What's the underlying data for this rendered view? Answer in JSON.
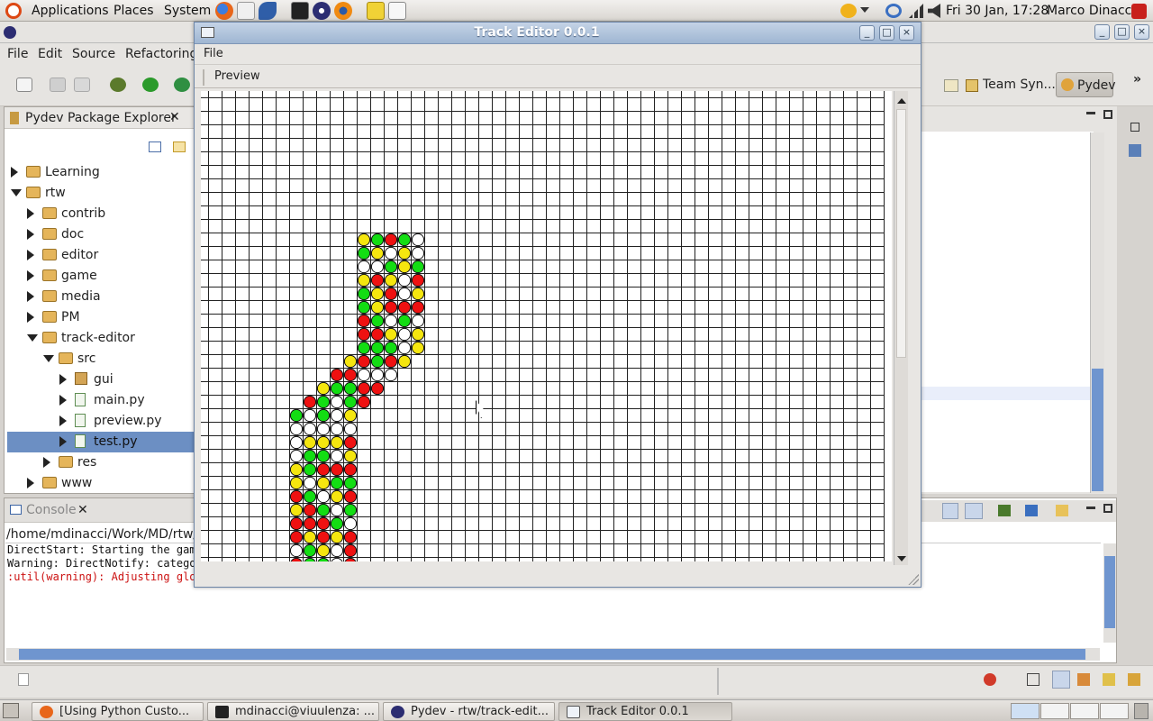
{
  "topbar": {
    "menus": [
      "Applications",
      "Places",
      "System"
    ],
    "clock": "Fri 30 Jan, 17:28",
    "user": "Marco Dinacci"
  },
  "eclipse": {
    "menus": [
      "File",
      "Edit",
      "Source",
      "Refactoring"
    ],
    "perspectives": [
      "Team Syn...",
      "Pydev"
    ],
    "explorer_title": "Pydev Package Explorer",
    "tree": [
      {
        "label": "Learning",
        "depth": 0,
        "expanded": false,
        "kind": "folder"
      },
      {
        "label": "rtw",
        "depth": 0,
        "expanded": true,
        "kind": "folder"
      },
      {
        "label": "contrib",
        "depth": 1,
        "expanded": false,
        "kind": "folder"
      },
      {
        "label": "doc",
        "depth": 1,
        "expanded": false,
        "kind": "folder"
      },
      {
        "label": "editor",
        "depth": 1,
        "expanded": false,
        "kind": "folder"
      },
      {
        "label": "game",
        "depth": 1,
        "expanded": false,
        "kind": "folder"
      },
      {
        "label": "media",
        "depth": 1,
        "expanded": false,
        "kind": "folder"
      },
      {
        "label": "PM",
        "depth": 1,
        "expanded": false,
        "kind": "folder"
      },
      {
        "label": "track-editor",
        "depth": 1,
        "expanded": true,
        "kind": "folder"
      },
      {
        "label": "src",
        "depth": 2,
        "expanded": true,
        "kind": "folder"
      },
      {
        "label": "gui",
        "depth": 3,
        "expanded": false,
        "kind": "package"
      },
      {
        "label": "main.py",
        "depth": 3,
        "expanded": false,
        "kind": "file"
      },
      {
        "label": "preview.py",
        "depth": 3,
        "expanded": false,
        "kind": "file"
      },
      {
        "label": "test.py",
        "depth": 3,
        "expanded": false,
        "kind": "file",
        "selected": true
      },
      {
        "label": "res",
        "depth": 2,
        "expanded": false,
        "kind": "folder"
      },
      {
        "label": "www",
        "depth": 1,
        "expanded": false,
        "kind": "folder"
      }
    ],
    "console_title": "Console",
    "console_path": "/home/mdinacci/Work/MD/rtw/trac",
    "console_lines": [
      {
        "text": "DirectStart: Starting the game",
        "color": "#111111"
      },
      {
        "text": "Warning: DirectNotify: categor",
        "color": "#111111"
      },
      {
        "text": ":util(warning): Adjusting glob",
        "color": "#cc1111"
      }
    ]
  },
  "track_editor": {
    "title": "Track Editor 0.0.1",
    "menu": "File",
    "toolbar_button": "Preview",
    "grid_cols": 50,
    "grid_rows": 35,
    "palette": {
      "Y": "#f5e60f",
      "G": "#13dd13",
      "R": "#ee1111",
      "W": "#ffffff"
    },
    "tiles": [
      {
        "row": 10,
        "col": 11,
        "colors": "YGRGW"
      },
      {
        "row": 11,
        "col": 11,
        "colors": "GYWYW"
      },
      {
        "row": 12,
        "col": 11,
        "colors": "WWGYG"
      },
      {
        "row": 13,
        "col": 11,
        "colors": "YRYWR"
      },
      {
        "row": 14,
        "col": 11,
        "colors": "GYRWY"
      },
      {
        "row": 15,
        "col": 11,
        "colors": "GYRRR"
      },
      {
        "row": 16,
        "col": 11,
        "colors": "RGWGW"
      },
      {
        "row": 17,
        "col": 11,
        "colors": "RRYWY"
      },
      {
        "row": 18,
        "col": 11,
        "colors": "GGGWY"
      },
      {
        "row": 19,
        "col": 10,
        "colors": "YRGRY"
      },
      {
        "row": 20,
        "col": 9,
        "colors": "RRWWW"
      },
      {
        "row": 21,
        "col": 8,
        "colors": "YGGRR"
      },
      {
        "row": 22,
        "col": 7,
        "colors": "RGWGR"
      },
      {
        "row": 23,
        "col": 6,
        "colors": "GWGWY"
      },
      {
        "row": 24,
        "col": 6,
        "colors": "WWWWW"
      },
      {
        "row": 25,
        "col": 6,
        "colors": "WYYYR"
      },
      {
        "row": 26,
        "col": 6,
        "colors": "WGGWY"
      },
      {
        "row": 27,
        "col": 6,
        "colors": "YGRRR"
      },
      {
        "row": 28,
        "col": 6,
        "colors": "YWYGG"
      },
      {
        "row": 29,
        "col": 6,
        "colors": "RGWYR"
      },
      {
        "row": 30,
        "col": 6,
        "colors": "YRGWG"
      },
      {
        "row": 31,
        "col": 6,
        "colors": "RRRGW"
      },
      {
        "row": 32,
        "col": 6,
        "colors": "RYRYR"
      },
      {
        "row": 33,
        "col": 6,
        "colors": "WGYWR"
      },
      {
        "row": 34,
        "col": 6,
        "colors": "RGGWR"
      }
    ]
  },
  "taskbar": [
    {
      "label": "[Using Python Custo...",
      "icon": "firefox-icon",
      "active": false
    },
    {
      "label": "mdinacci@viuulenza: ...",
      "icon": "terminal-icon",
      "active": false
    },
    {
      "label": "Pydev - rtw/track-edit...",
      "icon": "eclipse-icon",
      "active": false
    },
    {
      "label": "Track Editor 0.0.1",
      "icon": "window-icon",
      "active": true
    }
  ]
}
